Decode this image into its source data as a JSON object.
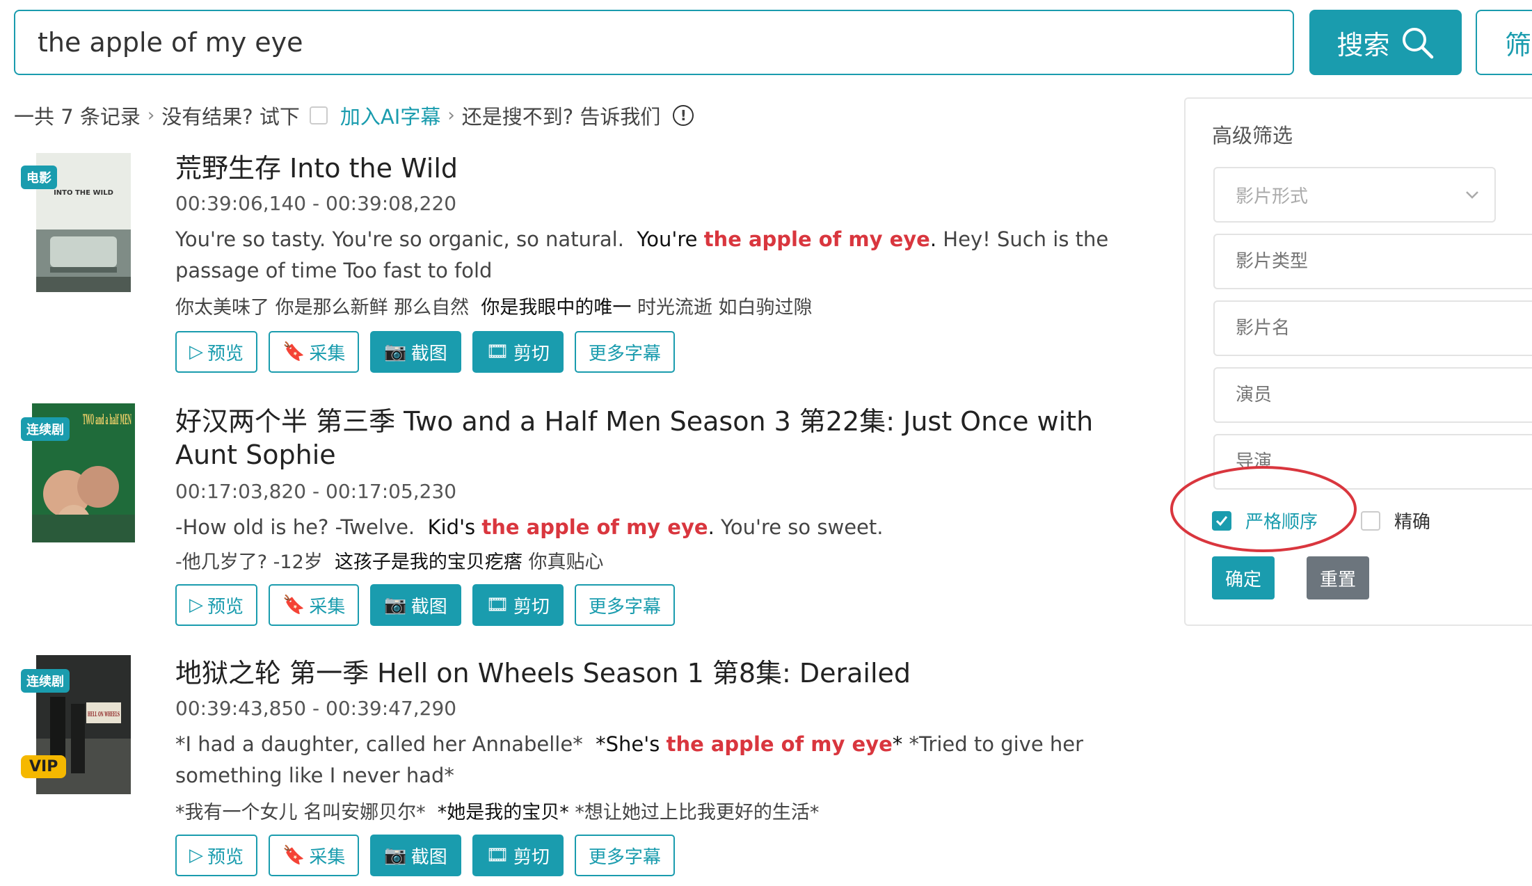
{
  "search": {
    "value": "the apple of my eye",
    "button_label": "搜索",
    "filter_label": "筛"
  },
  "summary": {
    "count_text": "一共 7 条记录",
    "no_result_text": "没有结果? 试下",
    "ai_link": "加入AI字幕",
    "report_text": "还是搜不到? 告诉我们"
  },
  "actions": {
    "preview": "预览",
    "collect": "采集",
    "screenshot": "截图",
    "cut": "剪切",
    "more": "更多字幕"
  },
  "results": [
    {
      "badge": "电影",
      "vip": "",
      "poster_text": "INTO THE WILD",
      "title": "荒野生存 Into the Wild",
      "time": "00:39:06,140 - 00:39:08,220",
      "en_before": "You're so tasty. You're so organic, so natural.",
      "en_match_pre": "You're ",
      "en_highlight": "the apple of my eye",
      "en_match_post": ".",
      "en_after": "Hey! Such is the passage of time Too fast to fold",
      "zh_before": "你太美味了 你是那么新鲜 那么自然",
      "zh_match": "你是我眼中的唯一",
      "zh_after": "时光流逝 如白驹过隙"
    },
    {
      "badge": "连续剧",
      "vip": "",
      "poster_text": "TWO and a half MEN",
      "title": "好汉两个半 第三季 Two and a Half Men Season 3 第22集: Just Once with Aunt Sophie",
      "time": "00:17:03,820 - 00:17:05,230",
      "en_before": "-How old is he? -Twelve.",
      "en_match_pre": "Kid's ",
      "en_highlight": "the apple of my eye",
      "en_match_post": ".",
      "en_after": "You're so sweet.",
      "zh_before": "-他几岁了? -12岁",
      "zh_match": "这孩子是我的宝贝疙瘩",
      "zh_after": "你真贴心"
    },
    {
      "badge": "连续剧",
      "vip": "VIP",
      "poster_text": "HELL ON WHEELS",
      "title": "地狱之轮 第一季 Hell on Wheels Season 1 第8集: Derailed",
      "time": "00:39:43,850 - 00:39:47,290",
      "en_before": "*I had a daughter, called her Annabelle*",
      "en_match_pre": "*She's ",
      "en_highlight": "the apple of my eye",
      "en_match_post": "*",
      "en_after": "*Tried to give her something like I never had*",
      "zh_before": "*我有一个女儿 名叫安娜贝尔*",
      "zh_match": "*她是我的宝贝*",
      "zh_after": "*想让她过上比我更好的生活*"
    }
  ],
  "panel": {
    "title": "高级筛选",
    "format_placeholder": "影片形式",
    "type_placeholder": "影片类型",
    "name_placeholder": "影片名",
    "actor_placeholder": "演员",
    "director_placeholder": "导演",
    "strict_label": "严格顺序",
    "strict_checked": true,
    "exact_label": "精确",
    "exact_checked": false,
    "ok_label": "确定",
    "reset_label": "重置"
  },
  "colors": {
    "accent": "#1a9cae",
    "highlight": "#d9363e",
    "vip": "#f5b800",
    "annotation": "#d9363e"
  }
}
